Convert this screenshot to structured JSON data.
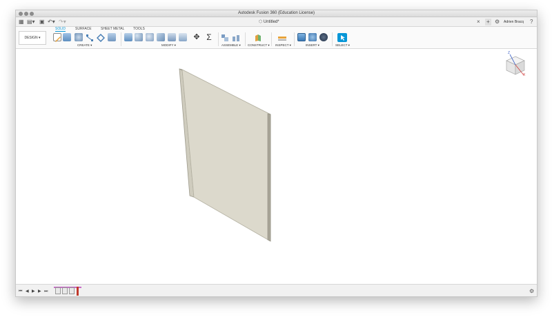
{
  "window": {
    "title": "Autodesk Fusion 360 (Education License)",
    "document_tab": "Untitled*",
    "user_name": "Adrien Bracq"
  },
  "ribbon": {
    "workspace": "DESIGN ▾",
    "tabs": [
      "SOLID",
      "SURFACE",
      "SHEET METAL",
      "TOOLS"
    ],
    "active_tab": "SOLID",
    "groups": [
      "CREATE ▾",
      "MODIFY ▾",
      "ASSEMBLE ▾",
      "CONSTRUCT ▾",
      "INSPECT ▾",
      "INSERT ▾",
      "SELECT ▾"
    ],
    "modify_glyphs": {
      "move": "✥",
      "sigma": "Σ"
    }
  },
  "viewcube": {
    "axis_z": "Z",
    "axis_x": "X"
  },
  "colors": {
    "accent": "#0696d7",
    "body_face": "#dcd9cc",
    "body_edge": "#b5b2a3"
  }
}
